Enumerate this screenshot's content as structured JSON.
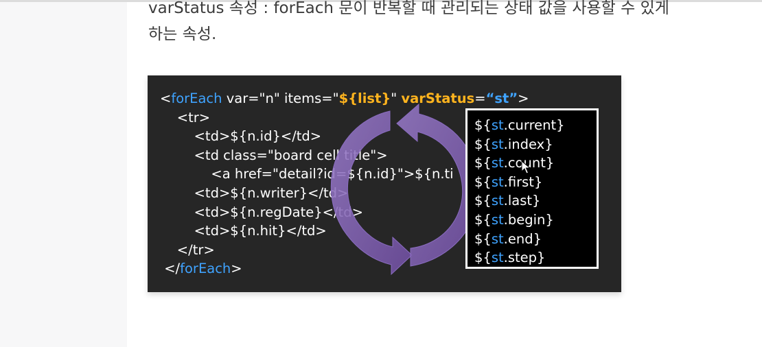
{
  "description": {
    "line1": "varStatus 속성 : forEach 문이 반복할 때 관리되는 상태 값을 사용할 수 있게",
    "line2": "하는 속성."
  },
  "slide": {
    "code_lines": {
      "l1": {
        "open": "<",
        "tag": "forEach",
        "attrs": " var=\"n\" items=\"",
        "list": "${list}",
        "mid": "\" ",
        "varstatus": "varStatus",
        "eq": "=",
        "st": "“st”",
        "close": ">"
      },
      "l2": "    <tr>",
      "l3": "        <td>${n.id}</td>",
      "l4": "        <td class=\"board cell title\">",
      "l5": "            <a href=\"detail?id=${n.id}\">${n.ti",
      "l6": "        <td>${n.writer}</td>",
      "l7": "        <td>${n.regDate}</td>",
      "l8": "        <td>${n.hit}</td>",
      "l9": "    </tr>",
      "l10": {
        "open": "</",
        "tag": "forEach",
        "close": ">"
      }
    },
    "status_items": [
      {
        "prefix": "${",
        "var": "st",
        "prop": ".current}"
      },
      {
        "prefix": "${",
        "var": "st",
        "prop": ".index}"
      },
      {
        "prefix": "${",
        "var": "st",
        "prop": ".count}"
      },
      {
        "prefix": "${",
        "var": "st",
        "prop": ".first}"
      },
      {
        "prefix": "${",
        "var": "st",
        "prop": ".last}"
      },
      {
        "prefix": "${",
        "var": "st",
        "prop": ".begin}"
      },
      {
        "prefix": "${",
        "var": "st",
        "prop": ".end}"
      },
      {
        "prefix": "${",
        "var": "st",
        "prop": ".step}"
      }
    ]
  },
  "colors": {
    "keyword": "#3fa3ff",
    "highlight": "#ffb41e",
    "slide_bg": "#262626",
    "arrow": "#7b5aa6"
  },
  "icons": {
    "cycle": "circular-arrows-icon",
    "cursor": "mouse-pointer-icon"
  }
}
